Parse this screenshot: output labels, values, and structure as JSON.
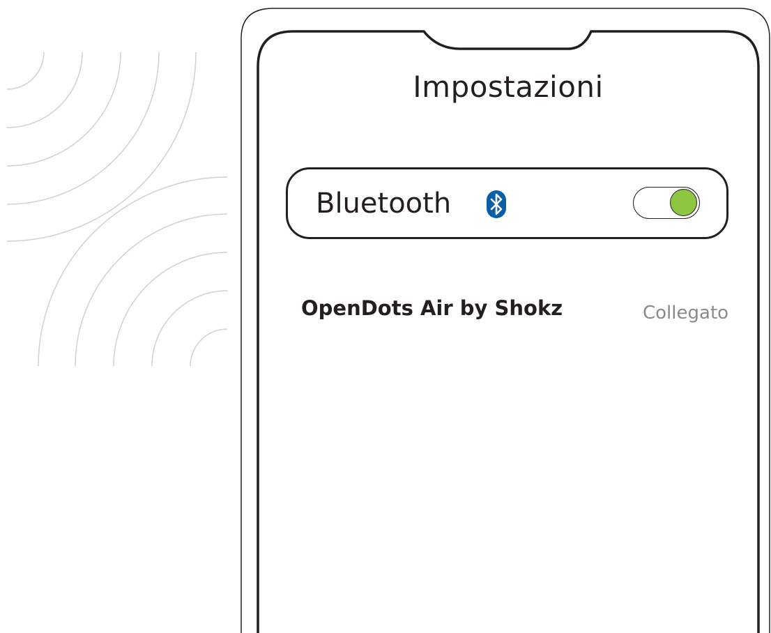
{
  "screen": {
    "title": "Impostazioni"
  },
  "bluetooth": {
    "label": "Bluetooth",
    "enabled": true,
    "icon": "bluetooth-icon",
    "icon_color": "#0a5ea8",
    "toggle_on_color": "#8dc63f"
  },
  "devices": [
    {
      "name": "OpenDots Air by Shokz",
      "status": "Collegato"
    }
  ]
}
